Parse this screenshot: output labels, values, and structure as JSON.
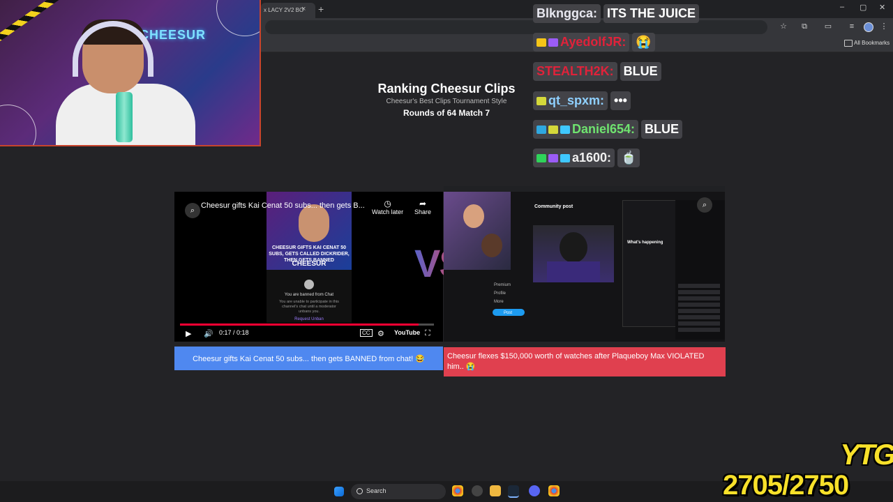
{
  "browser": {
    "tab_title": "x LACY 2V2 BO",
    "tab_close": "×",
    "new_tab": "+",
    "window_minimize": "–",
    "window_maximize": "▢",
    "window_close": "✕",
    "bookmarks_label": "All Bookmarks",
    "toolbar_star": "☆",
    "toolbar_ext": "⧉",
    "toolbar_menu": "⋮"
  },
  "webcam": {
    "neon_text": "CHEESUR"
  },
  "page": {
    "title": "Ranking Cheesur Clips",
    "subtitle": "Cheesur's Best Clips Tournament Style",
    "round": "Rounds of 64 Match 7",
    "vs_text": "VS"
  },
  "chat": [
    {
      "user": "Blknggca:",
      "message": "ITS THE JUICE",
      "user_color": "#e8e8f0",
      "badges": []
    },
    {
      "user": "AyedolfJR:",
      "message": "😭",
      "user_color": "#e0223a",
      "badges": [
        "#f5c518",
        "#9b5cf6"
      ]
    },
    {
      "user": "STEALTH2K:",
      "message": "BLUE",
      "user_color": "#e0223a",
      "badges": []
    },
    {
      "user": "qt_spxm:",
      "message": "•••",
      "user_color": "#8fd0ff",
      "badges": [
        "#d4d83a"
      ]
    },
    {
      "user": "Daniel654:",
      "message": "BLUE",
      "user_color": "#6fe36f",
      "badges": [
        "#2fa8e0",
        "#d4d83a",
        "#3fc8ff"
      ]
    },
    {
      "user": "a1600:",
      "message": "🍵",
      "user_color": "#f0f0f0",
      "badges": [
        "#2fd35a",
        "#9b5cf6",
        "#3fc8ff"
      ]
    }
  ],
  "left_video": {
    "title": "Cheesur gifts Kai Cenat 50 subs... then gets B...",
    "watch_later": "Watch later",
    "share": "Share",
    "thumb_caption": "CHEESUR GIFTS KAI CENAT 50 SUBS, GETS CALLED DICKRIDER, THEN GETS BANNED",
    "thumb_brand": "CHEESUR",
    "ban_title": "You are banned from Chat",
    "ban_body": "You are unable to participate in this channel's chat until a moderator unbans you.",
    "ban_request": "Request Unban",
    "time": "0:17 / 0:18",
    "progress_fraction": 0.94,
    "youtube_label": "YouTube",
    "caption": "Cheesur gifts Kai Cenat 50 subs... then gets BANNED from chat! 😂"
  },
  "right_video": {
    "post_header": "Community post",
    "whats_happening": "What's happening",
    "nav_items": [
      "Premium",
      "Profile",
      "More"
    ],
    "post_label": "Post",
    "caption": "Cheesur flexes $150,000 worth of watches after Plaqueboy Max VIOLATED him.. 😭"
  },
  "taskbar": {
    "search_label": "Search"
  },
  "overlay": {
    "brand": "YTG",
    "counter": "2705/2750"
  }
}
